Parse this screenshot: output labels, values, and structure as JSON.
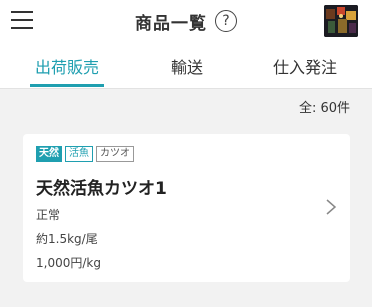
{
  "header": {
    "title": "商品一覧",
    "help_glyph": "?"
  },
  "tabs": [
    {
      "label": "出荷販売",
      "active": true
    },
    {
      "label": "輸送",
      "active": false
    },
    {
      "label": "仕入発注",
      "active": false
    }
  ],
  "summary": {
    "total": "全: 60件"
  },
  "products": [
    {
      "tags": [
        "天然",
        "活魚",
        "カツオ"
      ],
      "name": "天然活魚カツオ1",
      "status": "正常",
      "weight": "約1.5kg/尾",
      "price": "1,000円/kg"
    }
  ],
  "colors": {
    "accent": "#1f9fb0",
    "background": "#f2f2f2"
  },
  "icons": [
    "menu-icon",
    "help-icon",
    "chevron-right-icon"
  ]
}
